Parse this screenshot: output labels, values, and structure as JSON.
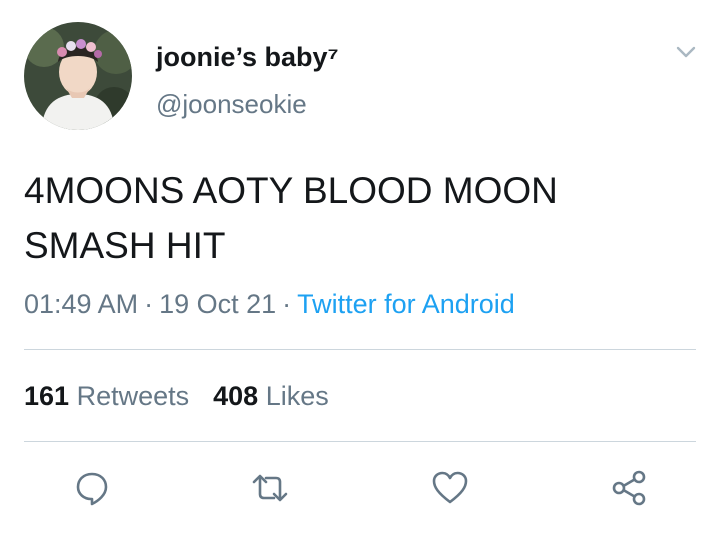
{
  "user": {
    "display_name": "joonie’s baby⁷",
    "handle": "@joonseokie",
    "avatar_icon": "profile-photo"
  },
  "tweet": {
    "text_line1": "4MOONS AOTY BLOOD MOON",
    "text_line2": "SMASH HIT",
    "time": "01:49 AM",
    "date": "19 Oct 21",
    "separator": "·",
    "source": "Twitter for Android"
  },
  "stats": {
    "retweets_count": "161",
    "retweets_label": "Retweets",
    "likes_count": "408",
    "likes_label": "Likes"
  },
  "actions": [
    {
      "name": "reply",
      "icon": "speech-bubble-icon"
    },
    {
      "name": "retweet",
      "icon": "retweet-arrows-icon"
    },
    {
      "name": "like",
      "icon": "heart-icon"
    },
    {
      "name": "share",
      "icon": "share-nodes-icon"
    }
  ],
  "colors": {
    "text_primary": "#14171a",
    "text_secondary": "#657786",
    "link": "#1da1f2",
    "divider": "#ccd6dd",
    "icon": "#657786"
  }
}
